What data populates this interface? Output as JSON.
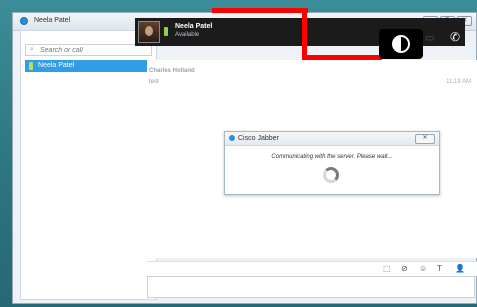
{
  "window": {
    "title": "Neela Patel",
    "buttons": [
      "▭",
      "⧉",
      "✕"
    ]
  },
  "sidebar": {
    "search_placeholder": "Search or call",
    "contacts": [
      {
        "name": "Neela Patel",
        "selected": true,
        "presence_color": "#b6e34b"
      }
    ]
  },
  "chat_header": {
    "name": "Neela Patel",
    "status": "Available",
    "presence_color": "#8fd14f",
    "icons": [
      "avatar",
      "record-icon",
      "screen-share-icon",
      "phone-icon"
    ]
  },
  "conversation": {
    "messages": [
      {
        "author": "Charles Holland",
        "text": "test",
        "time": "11:19 AM"
      }
    ]
  },
  "dialog": {
    "title": "Cisco Jabber",
    "message": "Communicating with the server. Please wait...",
    "close_label": "✕"
  },
  "toolbar": {
    "icons": [
      "screen-capture-icon",
      "attachment-icon",
      "emoticon-icon",
      "font-icon",
      "add-participant-icon"
    ]
  },
  "colors": {
    "accent": "#2f9ee6",
    "annotation": "#ff0000",
    "header_bg": "#1b1b1b"
  }
}
